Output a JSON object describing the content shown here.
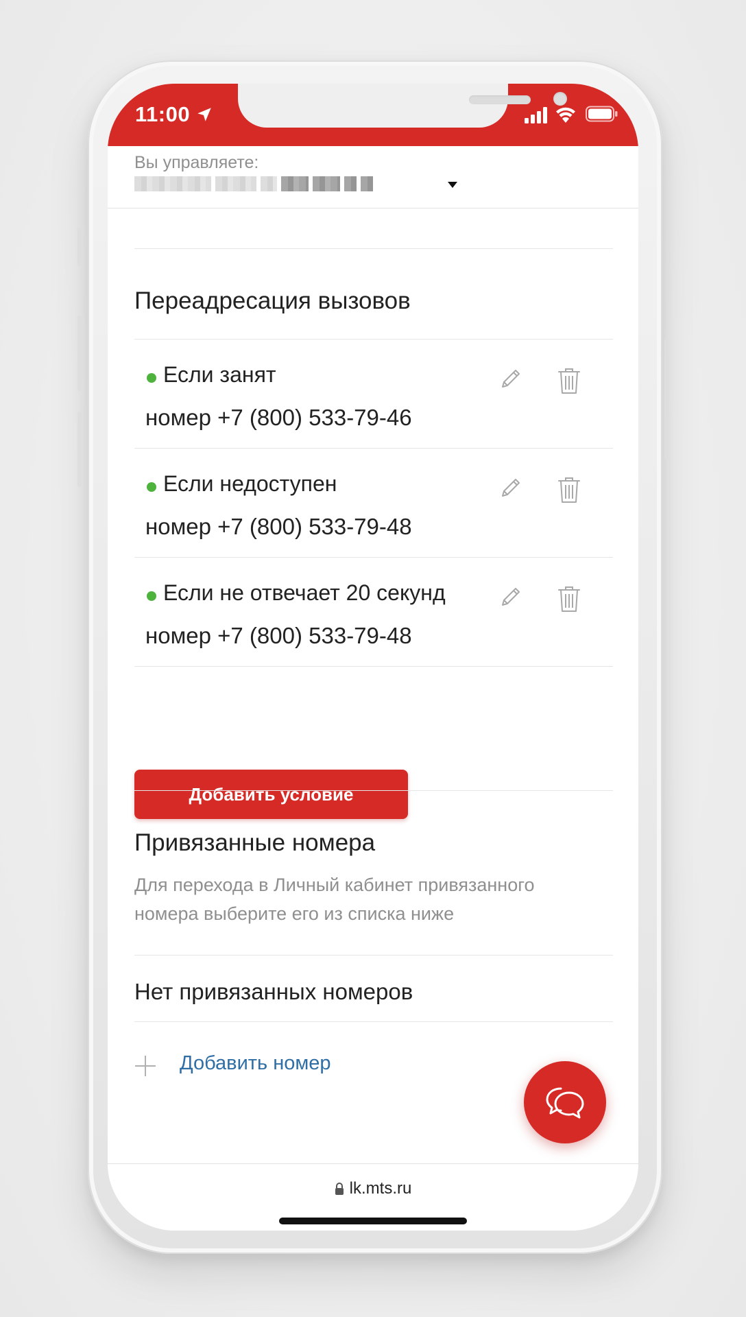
{
  "status_bar": {
    "time": "11:00",
    "icons": [
      "location-arrow-icon",
      "cellular-signal-icon",
      "wifi-icon",
      "battery-icon"
    ]
  },
  "account": {
    "manage_label": "Вы управляете:",
    "number_masked": "██████ ████ ██ ███ ███-█-█"
  },
  "forwarding": {
    "title": "Переадресация вызовов",
    "rules": [
      {
        "condition": "Если занят",
        "number": "номер +7 (800) 533-79-46",
        "active": true
      },
      {
        "condition": "Если недоступен",
        "number": "номер +7 (800) 533-79-48",
        "active": true
      },
      {
        "condition": "Если не отвечает 20 секунд",
        "number": "номер +7 (800) 533-79-48",
        "active": true
      }
    ],
    "add_button_label": "Добавить условие"
  },
  "linked_numbers": {
    "title": "Привязанные номера",
    "description": "Для перехода в Личный кабинет привязанного номера выберите его из списка ниже",
    "empty_text": "Нет привязанных номеров",
    "add_label": "Добавить номер"
  },
  "chat": {
    "icon": "chat-bubbles-icon"
  },
  "browser": {
    "url": "lk.mts.ru"
  },
  "colors": {
    "brand_red": "#d52a26",
    "active_green": "#4db33d",
    "link_blue": "#2f6fa5",
    "muted_gray": "#8f8f8f"
  }
}
